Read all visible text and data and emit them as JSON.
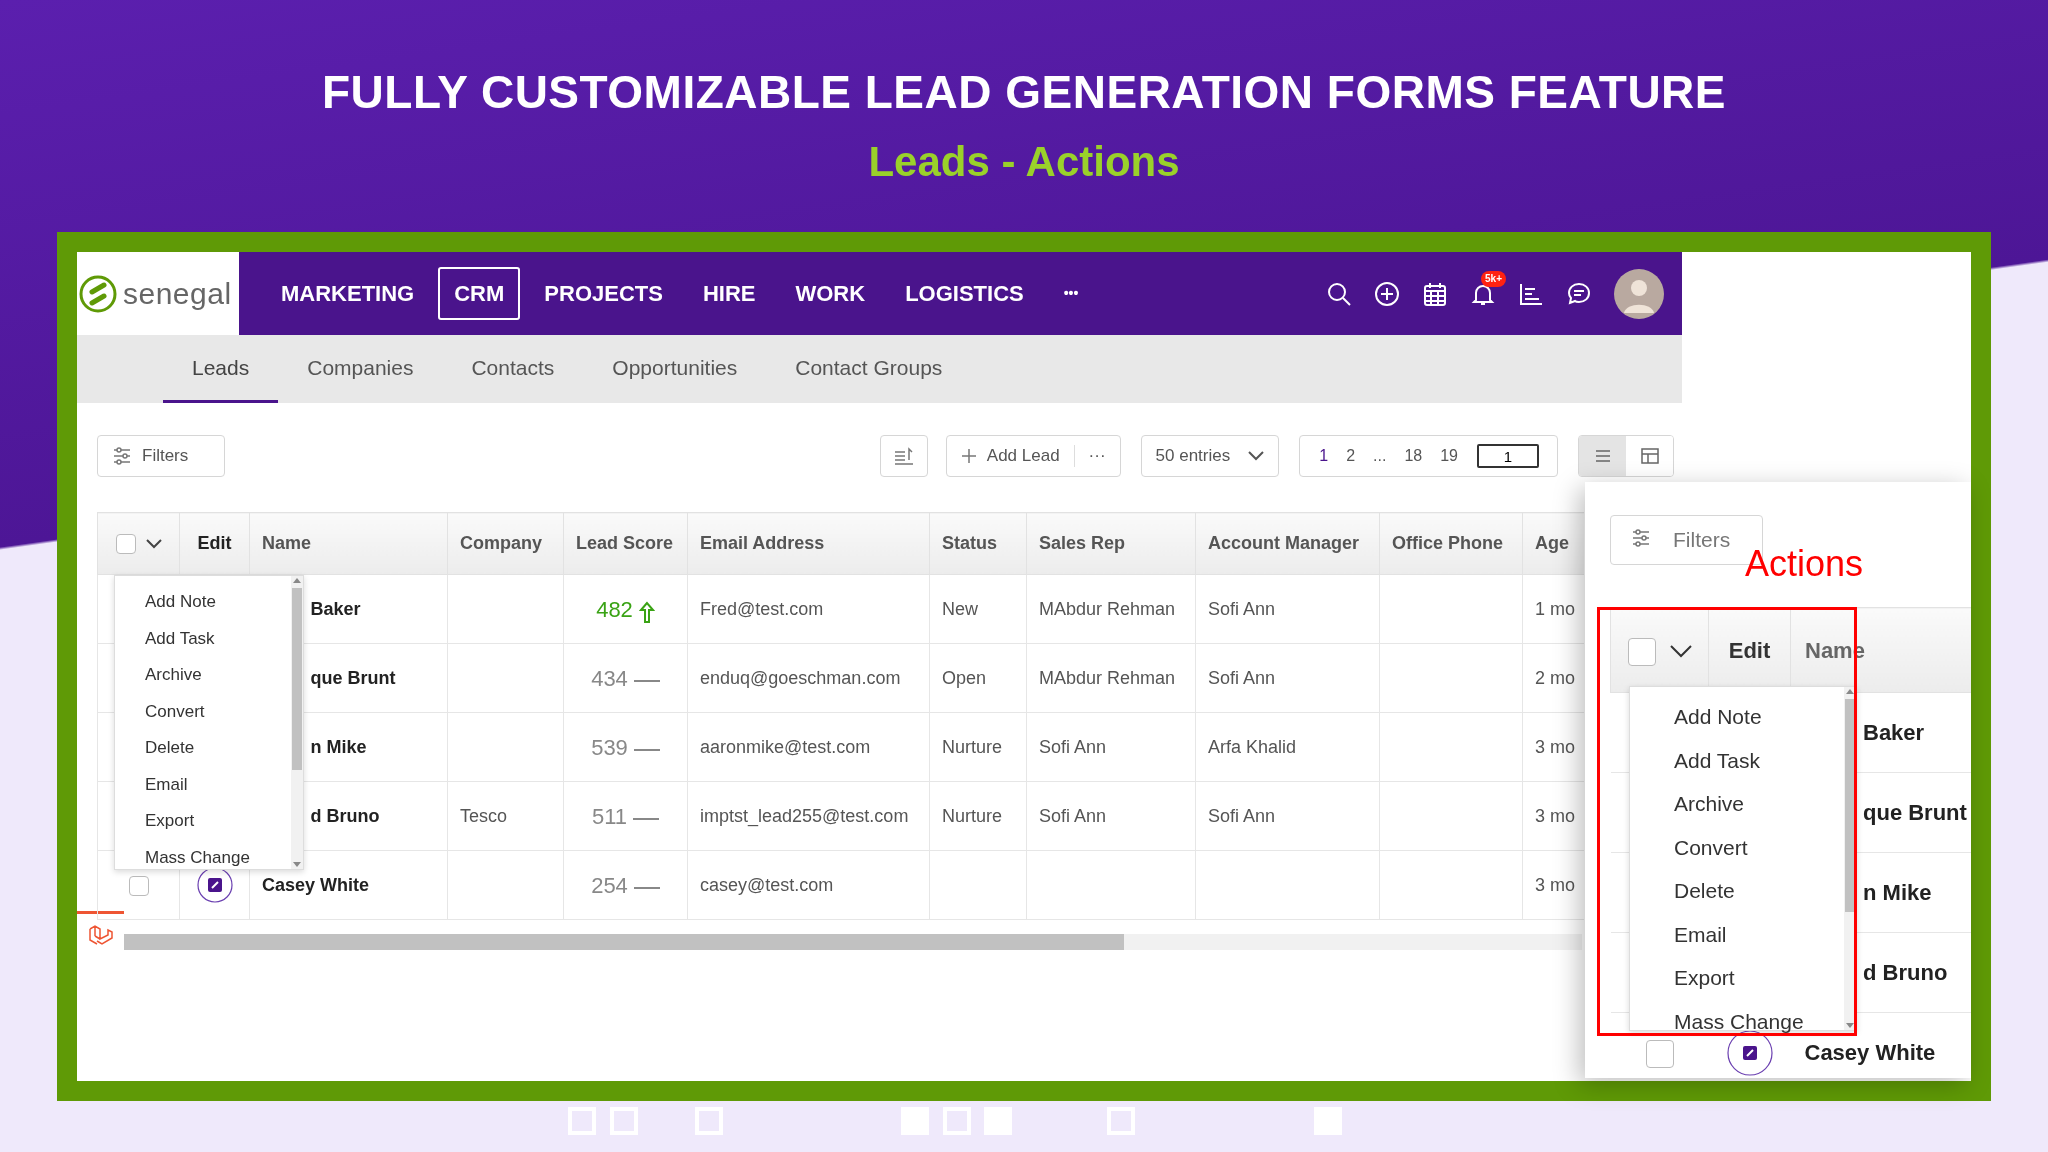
{
  "banner": {
    "title": "FULLY CUSTOMIZABLE LEAD GENERATION FORMS FEATURE",
    "subtitle": "Leads - Actions"
  },
  "app": {
    "logo_text": "senegal",
    "nav": [
      {
        "label": "MARKETING",
        "selected": false
      },
      {
        "label": "CRM",
        "selected": true
      },
      {
        "label": "PROJECTS",
        "selected": false
      },
      {
        "label": "HIRE",
        "selected": false
      },
      {
        "label": "WORK",
        "selected": false
      },
      {
        "label": "LOGISTICS",
        "selected": false
      }
    ],
    "nav_more": "•••",
    "notification_badge": "5k+",
    "subnav": [
      {
        "label": "Leads",
        "selected": true
      },
      {
        "label": "Companies",
        "selected": false
      },
      {
        "label": "Contacts",
        "selected": false
      },
      {
        "label": "Opportunities",
        "selected": false
      },
      {
        "label": "Contact Groups",
        "selected": false
      }
    ]
  },
  "toolbar": {
    "filters": "Filters",
    "add_lead": "Add Lead",
    "more": "···",
    "entries": "50 entries",
    "pages": [
      {
        "label": "1",
        "selected": true
      },
      {
        "label": "2",
        "selected": false
      },
      {
        "label": "...",
        "selected": false
      },
      {
        "label": "18",
        "selected": false
      },
      {
        "label": "19",
        "selected": false
      }
    ],
    "page_input": "1",
    "views": [
      {
        "kind": "list",
        "selected": true
      },
      {
        "kind": "grid",
        "selected": false
      }
    ]
  },
  "table": {
    "select_all_checked": false,
    "columns": [
      "Edit",
      "Name",
      "Company",
      "Lead Score",
      "Email Address",
      "Status",
      "Sales Rep",
      "Account Manager",
      "Office Phone",
      "Age"
    ],
    "rows": [
      {
        "name": "Baker",
        "company": "",
        "score": "482",
        "kind": "rising",
        "email": "Fred@test.com",
        "status": "New",
        "sales_rep": "MAbdur Rehman",
        "account_manager": "Sofi Ann",
        "office_phone": "",
        "age": "1 mo"
      },
      {
        "name": "que Brunt",
        "company": "",
        "score": "434",
        "kind": "steady",
        "email": "enduq@goeschman.com",
        "status": "Open",
        "sales_rep": "MAbdur Rehman",
        "account_manager": "Sofi Ann",
        "office_phone": "",
        "age": "2 mo"
      },
      {
        "name": "n Mike",
        "company": "",
        "score": "539",
        "kind": "steady",
        "email": "aaronmike@test.com",
        "status": "Nurture",
        "sales_rep": "Sofi Ann",
        "account_manager": "Arfa Khalid",
        "office_phone": "",
        "age": "3 mo"
      },
      {
        "name": "d Bruno",
        "company": "Tesco",
        "score": "511",
        "kind": "steady",
        "email": "imptst_lead255@test.com",
        "status": "Nurture",
        "sales_rep": "Sofi Ann",
        "account_manager": "Sofi Ann",
        "office_phone": "",
        "age": "3 mo"
      },
      {
        "name": "Casey White",
        "company": "",
        "score": "254",
        "kind": "steady",
        "email": "casey@test.com",
        "status": "",
        "sales_rep": "",
        "account_manager": "",
        "office_phone": "",
        "age": "3 mo",
        "checked": false
      }
    ]
  },
  "actions_menu": {
    "items": [
      "Add Note",
      "Add Task",
      "Archive",
      "Convert",
      "Delete",
      "Email",
      "Export",
      "Mass Change"
    ]
  },
  "inset": {
    "filters": "Filters",
    "callout": "Actions",
    "select_all_checked": false,
    "columns": [
      "Edit",
      "Name"
    ],
    "menu_items": [
      "Add Note",
      "Add Task",
      "Archive",
      "Convert",
      "Delete",
      "Email",
      "Export",
      "Mass Change"
    ],
    "rows": [
      {
        "name": "Baker"
      },
      {
        "name": "que Brunt"
      },
      {
        "name": "n Mike"
      },
      {
        "name": "d Bruno"
      },
      {
        "name": "Casey White",
        "checked": false
      }
    ]
  }
}
